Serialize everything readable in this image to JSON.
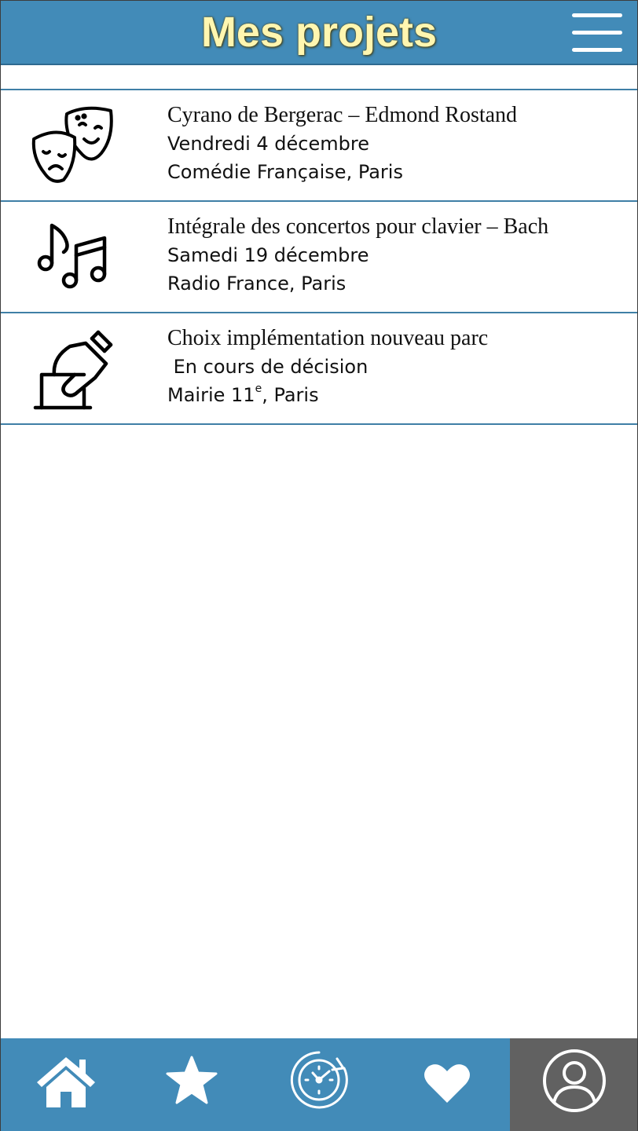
{
  "header": {
    "title": "Mes projets",
    "menu_icon": "hamburger-menu-icon"
  },
  "projects": [
    {
      "icon": "theater-masks-icon",
      "title": "Cyrano de Bergerac – Edmond Rostand",
      "date": "Vendredi 4 décembre",
      "place": "Comédie Française, Paris"
    },
    {
      "icon": "music-notes-icon",
      "title": "Intégrale des concertos pour clavier – Bach",
      "date": "Samedi 19 décembre",
      "place": "Radio France, Paris"
    },
    {
      "icon": "ballot-box-vote-icon",
      "title": "Choix implémentation nouveau parc",
      "date": " En cours de décision",
      "place_main": "Mairie 11",
      "place_sup": "e",
      "place_rest": ", Paris"
    }
  ],
  "bottom_nav": {
    "items": [
      "home-icon",
      "star-icon",
      "history-clock-icon",
      "heart-icon",
      "profile-icon"
    ],
    "active": "profile-icon"
  },
  "colors": {
    "header": "#428bb8",
    "title": "#fff6b0",
    "divider": "#3f7fa6",
    "profile_bg": "#616161"
  }
}
